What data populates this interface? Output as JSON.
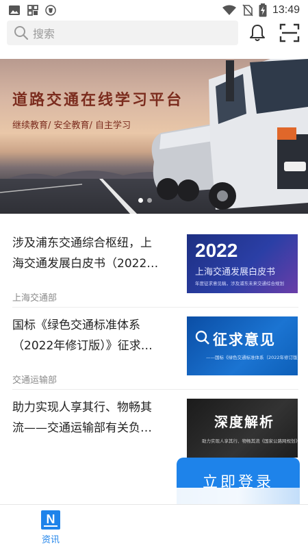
{
  "status_bar": {
    "time": "13:49",
    "icons": [
      "image-icon",
      "apps-icon",
      "shield-icon",
      "wifi-icon",
      "no-sim-icon",
      "battery-charging-icon"
    ]
  },
  "search": {
    "placeholder": "搜索",
    "icons": [
      "search-icon",
      "bell-icon",
      "scan-icon"
    ]
  },
  "banner": {
    "title": "道路交通在线学习平台",
    "subtitle": "继续教育/ 安全教育/ 自主学习",
    "slide_count": 2,
    "active_slide": 1
  },
  "news": [
    {
      "title_line1": "涉及浦东交通综合枢纽，上",
      "title_line2": "海交通发展白皮书（2022…",
      "source": "上海交通部",
      "thumb": {
        "big": "2022",
        "mid": "上海交通发展白皮书",
        "small": "年度征求意见稿，涉及浦东未来交通综合规划"
      }
    },
    {
      "title_line1": "国标《绿色交通标准体系",
      "title_line2": "（2022年修订版）》征求…",
      "source": "交通运输部",
      "thumb": {
        "big": "征求意见",
        "small": "——国标《绿色交通标准体系（2022年修订版）》——"
      }
    },
    {
      "title_line1": "助力实现人享其行、物畅其",
      "title_line2": "流——交通运输部有关负…",
      "source": "",
      "thumb": {
        "big": "深度解析",
        "small": "助力实现人享其行、物畅其流《国家公路网规划》"
      }
    }
  ],
  "login_button": "立即登录",
  "bottom_nav": {
    "items": [
      {
        "label": "资讯",
        "icon_letter": "N",
        "active": true
      }
    ]
  },
  "colors": {
    "accent": "#1e83ea",
    "banner_text": "#7b2c1e"
  }
}
